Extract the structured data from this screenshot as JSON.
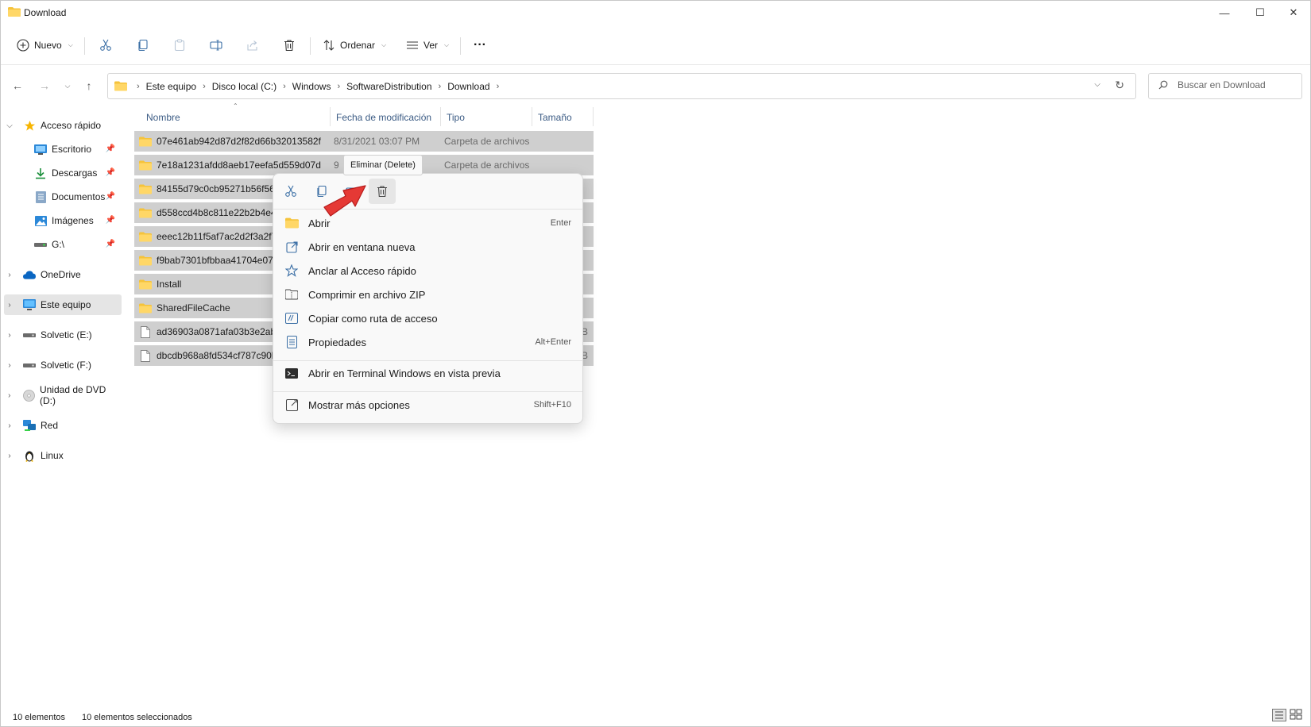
{
  "window": {
    "title": "Download",
    "controls": {
      "minimize": "—",
      "maximize": "☐",
      "close": "✕"
    }
  },
  "toolbar": {
    "new_label": "Nuevo",
    "sort_label": "Ordenar",
    "view_label": "Ver",
    "more_label": "···"
  },
  "address": {
    "breadcrumbs": [
      "Este equipo",
      "Disco local (C:)",
      "Windows",
      "SoftwareDistribution",
      "Download"
    ],
    "search_placeholder": "Buscar en Download"
  },
  "nav": {
    "items": [
      {
        "label": "Acceso rápido",
        "icon": "star-icon"
      },
      {
        "label": "Escritorio",
        "icon": "desktop-icon"
      },
      {
        "label": "Descargas",
        "icon": "download-icon"
      },
      {
        "label": "Documentos",
        "icon": "documents-icon"
      },
      {
        "label": "Imágenes",
        "icon": "pictures-icon"
      },
      {
        "label": "G:\\",
        "icon": "drive-icon"
      },
      {
        "label": "OneDrive",
        "icon": "cloud-icon"
      },
      {
        "label": "Este equipo",
        "icon": "monitor-icon"
      },
      {
        "label": "Solvetic (E:)",
        "icon": "drive-icon"
      },
      {
        "label": "Solvetic (F:)",
        "icon": "drive-icon"
      },
      {
        "label": "Unidad de DVD (D:)",
        "icon": "dvd-icon"
      },
      {
        "label": "Red",
        "icon": "network-icon"
      },
      {
        "label": "Linux",
        "icon": "linux-icon"
      }
    ]
  },
  "columns": {
    "name": "Nombre",
    "date": "Fecha de modificación",
    "type": "Tipo",
    "size": "Tamaño"
  },
  "files": [
    {
      "name": "07e461ab942d87d2f82d66b32013582f",
      "date": "8/31/2021 03:07 PM",
      "type": "Carpeta de archivos",
      "size": ""
    },
    {
      "name": "7e18a1231afdd8aeb17eefa5d559d07d",
      "date": "9",
      "type": "Carpeta de archivos",
      "size": ""
    },
    {
      "name": "84155d79c0cb95271b56f5666a",
      "date": "",
      "type": "",
      "size": ""
    },
    {
      "name": "d558ccd4b8c811e22b2b4e48e",
      "date": "",
      "type": "",
      "size": ""
    },
    {
      "name": "eeec12b11f5af7ac2d2f3a2f7bc",
      "date": "",
      "type": "",
      "size": ""
    },
    {
      "name": "f9bab7301bfbbaa41704e072e1",
      "date": "",
      "type": "",
      "size": ""
    },
    {
      "name": "Install",
      "date": "",
      "type": "",
      "size": ""
    },
    {
      "name": "SharedFileCache",
      "date": "",
      "type": "",
      "size": ""
    },
    {
      "name": "ad36903a0871afa03b3e2abe0c",
      "date": "",
      "type": "",
      "size": "KB"
    },
    {
      "name": "dbcdb968a8fd534cf787c90b35",
      "date": "",
      "type": "",
      "size": "KB"
    }
  ],
  "context_menu": {
    "tooltip": "Eliminar (Delete)",
    "items": [
      {
        "label": "Abrir",
        "shortcut": "Enter"
      },
      {
        "label": "Abrir en ventana nueva",
        "shortcut": ""
      },
      {
        "label": "Anclar al Acceso rápido",
        "shortcut": ""
      },
      {
        "label": "Comprimir en archivo ZIP",
        "shortcut": ""
      },
      {
        "label": "Copiar como ruta de acceso",
        "shortcut": ""
      },
      {
        "label": "Propiedades",
        "shortcut": "Alt+Enter"
      },
      {
        "label": "Abrir en Terminal Windows en vista previa",
        "shortcut": ""
      },
      {
        "label": "Mostrar más opciones",
        "shortcut": "Shift+F10"
      }
    ]
  },
  "status": {
    "count": "10 elementos",
    "selected": "10 elementos seleccionados"
  },
  "colors": {
    "folder": "#f5c33b",
    "selection": "#cfcfcf",
    "accent": "#0067c0",
    "arrow": "#e53935"
  }
}
